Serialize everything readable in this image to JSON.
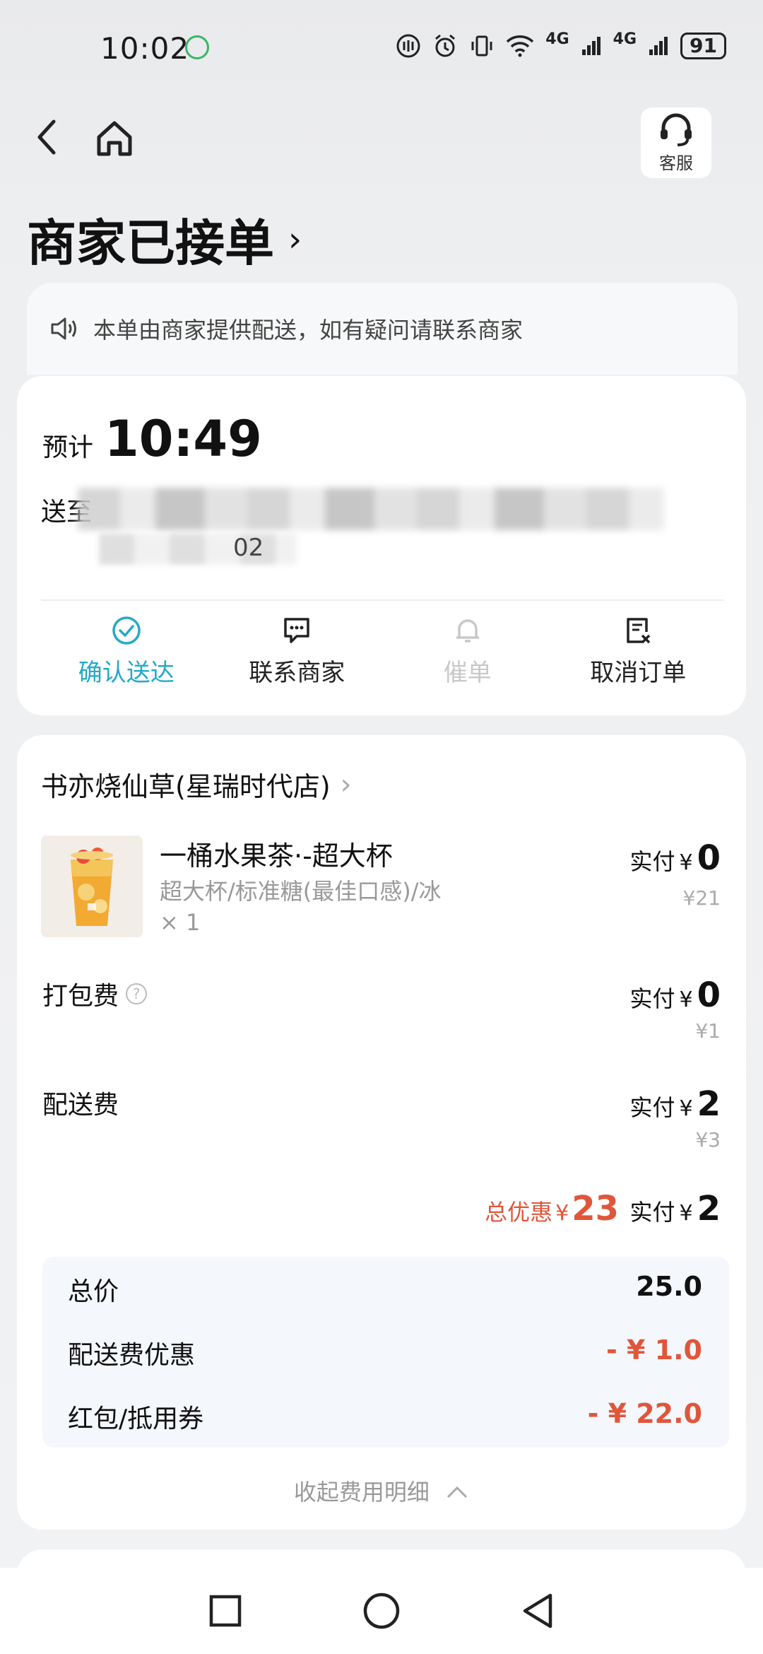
{
  "status_bar": {
    "time": "10:02",
    "battery": "91",
    "network_1": "4G",
    "network_2": "4G"
  },
  "header": {
    "customer_service_label": "客服",
    "order_status": "商家已接单"
  },
  "notice": {
    "text": "本单由商家提供配送，如有疑问请联系商家"
  },
  "delivery": {
    "eta_label": "预计",
    "eta_time": "10:49",
    "address_label": "送至",
    "address_tail": "02",
    "actions": [
      {
        "label": "确认送达",
        "state": "active",
        "icon": "check-circle-icon"
      },
      {
        "label": "联系商家",
        "state": "normal",
        "icon": "chat-icon"
      },
      {
        "label": "催单",
        "state": "disabled",
        "icon": "bell-icon"
      },
      {
        "label": "取消订单",
        "state": "normal",
        "icon": "cancel-order-icon"
      }
    ]
  },
  "order": {
    "shop_name": "书亦烧仙草(星瑞时代店)",
    "product": {
      "name": "一桶水果茶·-超大杯",
      "spec": "超大杯/标准糖(最佳口感)/冰",
      "qty": "× 1",
      "pay_label": "实付",
      "currency": "¥",
      "paid": "0",
      "original": "¥21"
    },
    "packing_fee": {
      "label": "打包费",
      "pay_label": "实付",
      "currency": "¥",
      "paid": "0",
      "original": "¥1"
    },
    "delivery_fee": {
      "label": "配送费",
      "pay_label": "实付",
      "currency": "¥",
      "paid": "2",
      "original": "¥3"
    },
    "summary": {
      "discount_label": "总优惠",
      "discount_currency": "¥",
      "discount_value": "23",
      "pay_label": "实付",
      "currency": "¥",
      "paid": "2"
    },
    "price_detail": {
      "total_label": "总价",
      "total_value": "25.0",
      "delivery_discount_label": "配送费优惠",
      "delivery_discount_value": "- ¥ 1.0",
      "coupon_label": "红包/抵用券",
      "coupon_value": "- ¥ 22.0"
    },
    "collapse_label": "收起费用明细"
  },
  "colors": {
    "accent": "#25a9c7",
    "discount_red": "#e0563b",
    "disabled": "#c8c8c8"
  }
}
